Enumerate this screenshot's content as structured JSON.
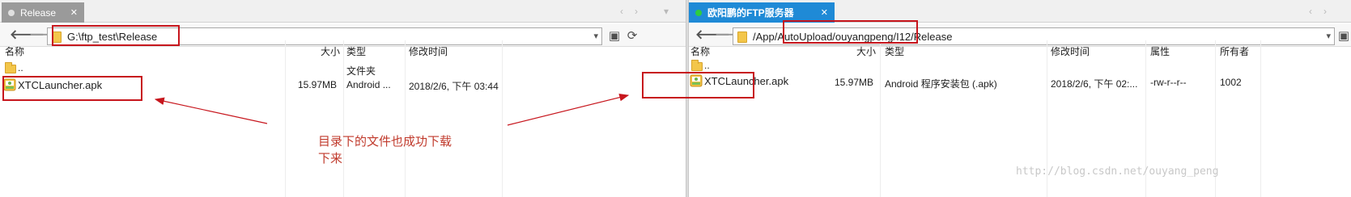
{
  "left": {
    "tab_label": "Release",
    "path": "G:\\ftp_test\\Release",
    "columns": [
      "名称",
      "大小",
      "类型",
      "修改时间"
    ],
    "rows": [
      {
        "name": "..",
        "size": "",
        "type": "文件夹",
        "modified": ""
      },
      {
        "name": "XTCLauncher.apk",
        "size": "15.97MB",
        "type": "Android ...",
        "modified": "2018/2/6, 下午 03:44"
      }
    ]
  },
  "right": {
    "tab_label": "欧阳鹏的FTP服务器",
    "path": "/App/AutoUpload/ouyangpeng/I12/Release",
    "columns": [
      "名称",
      "大小",
      "类型",
      "修改时间",
      "属性",
      "所有者"
    ],
    "rows": [
      {
        "name": "..",
        "size": "",
        "type": "",
        "modified": "",
        "attr": "",
        "owner": ""
      },
      {
        "name": "XTCLauncher.apk",
        "size": "15.97MB",
        "type": "Android 程序安装包 (.apk)",
        "modified": "2018/2/6, 下午 02:...",
        "attr": "-rw-r--r--",
        "owner": "1002"
      }
    ]
  },
  "annotation": {
    "line1": "目录下的文件也成功下载",
    "line2": "下来"
  },
  "watermark": "http://blog.csdn.net/ouyang_peng",
  "icons": {
    "back": "back-arrow-icon",
    "forward": "forward-arrow-icon",
    "folder": "folder-icon",
    "apk": "apk-file-icon",
    "refresh": "refresh-icon",
    "new_folder": "new-folder-icon"
  },
  "colors": {
    "annotation_red": "#c7161d",
    "active_tab": "#1f8ad6",
    "inactive_tab": "#9a9a9a",
    "connected_dot": "#2ecc40"
  }
}
